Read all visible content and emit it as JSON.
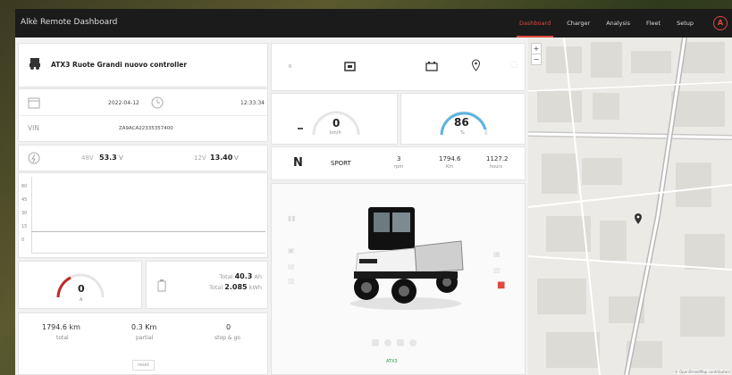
{
  "app": {
    "title": "Alkè Remote Dashboard",
    "nav": [
      "Dashboard",
      "Charger",
      "Analysis",
      "Fleet",
      "Setup"
    ],
    "logo": "A"
  },
  "vehicle": {
    "name": "ATX3 Ruote Grandi nuovo controller",
    "date": "2022-04-12",
    "time": "12:33:34",
    "vin_label": "VIN",
    "vin": "ZA9ACA22335357400"
  },
  "battery": {
    "hv_label": "48V",
    "hv_value": "53.3",
    "hv_unit": "V",
    "lv_label": "12V",
    "lv_value": "13.40",
    "lv_unit": "V"
  },
  "current": {
    "value": "0",
    "unit": "A"
  },
  "energy": {
    "ah_label": "Total",
    "ah_value": "40.3",
    "ah_unit": "Ah",
    "kwh_label": "Total",
    "kwh_value": "2.085",
    "kwh_unit": "kWh"
  },
  "trip": {
    "total_value": "1794.6 km",
    "total_label": "total",
    "partial_value": "0.3 Km",
    "partial_label": "partial",
    "sg_value": "0",
    "sg_label": "stop & go",
    "reset_label": "reset"
  },
  "speed": {
    "value": "0",
    "unit": "km/h"
  },
  "soc": {
    "value": "86",
    "unit": "%"
  },
  "status": {
    "gear": "N",
    "mode": "SPORT",
    "rpm_value": "3",
    "rpm_label": "rpm",
    "km_value": "1794.6",
    "km_label": "Km",
    "hours_value": "1127.2",
    "hours_label": "hours"
  },
  "chart": {
    "ticks": [
      "60",
      "45",
      "30",
      "15",
      "0"
    ]
  },
  "vehicle_view": {
    "model_badge": "ATX3"
  },
  "map": {
    "attribution": "© OpenStreetMap contributors",
    "zoom_in": "+",
    "zoom_out": "−"
  },
  "colors": {
    "accent": "#e0473e",
    "soc": "#5ab4e0"
  }
}
